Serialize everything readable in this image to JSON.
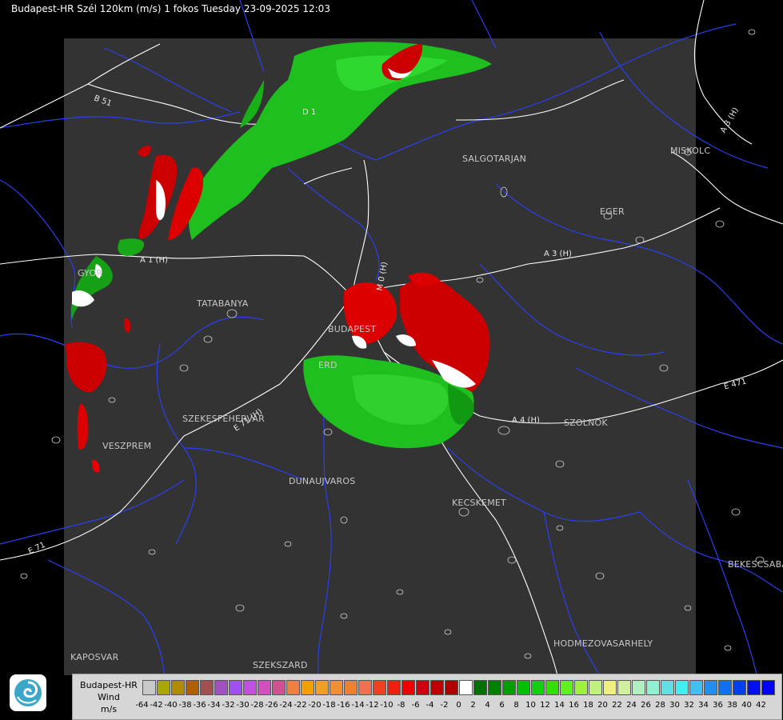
{
  "header": {
    "title": "Budapest-HR Szél 120km (m/s) 1 fokos Tuesday 23-09-2025 12:03"
  },
  "map": {
    "background_color": "#000000",
    "radar_area_color": "#333333",
    "border_color": "#3a3af0",
    "road_color": "#ffffff",
    "cities": [
      {
        "key": "salgotarjan",
        "label": "SALGOTARJAN"
      },
      {
        "key": "miskolc",
        "label": "MISKOLC"
      },
      {
        "key": "eger",
        "label": "EGER"
      },
      {
        "key": "tatabanya",
        "label": "TATABANYA"
      },
      {
        "key": "budapest",
        "label": "BUDAPEST"
      },
      {
        "key": "erd",
        "label": "ERD"
      },
      {
        "key": "szekesfehervar",
        "label": "SZEKESFEHERVAR"
      },
      {
        "key": "veszprem",
        "label": "VESZPREM"
      },
      {
        "key": "szolnok",
        "label": "SZOLNOK"
      },
      {
        "key": "dunaujvaros",
        "label": "DUNAUJVAROS"
      },
      {
        "key": "kecskemet",
        "label": "KECSKEMET"
      },
      {
        "key": "bekescsaba",
        "label": "BEKESCSABA"
      },
      {
        "key": "hodmezovasarhely",
        "label": "HODMEZOVASARHELY"
      },
      {
        "key": "kaposvar",
        "label": "KAPOSVAR"
      },
      {
        "key": "szekszard",
        "label": "SZEKSZARD"
      },
      {
        "key": "gyor",
        "label": "GYOR"
      }
    ],
    "roads": [
      {
        "key": "b51",
        "label": "B 51"
      },
      {
        "key": "d1",
        "label": "D 1"
      },
      {
        "key": "a3h_ne",
        "label": "A 3 (H)"
      },
      {
        "key": "a3h",
        "label": "A 3 (H)"
      },
      {
        "key": "a1h",
        "label": "A 1 (H)"
      },
      {
        "key": "m0",
        "label": "M 0 (H)"
      },
      {
        "key": "e471",
        "label": "E 471"
      },
      {
        "key": "a4h",
        "label": "A 4 (H)"
      },
      {
        "key": "e71",
        "label": "E 71 (H)"
      },
      {
        "key": "e71b",
        "label": "E 71"
      }
    ]
  },
  "legend": {
    "title": "Budapest-HR",
    "subtitle": "Wind",
    "unit": "m/s",
    "scale": [
      {
        "value": "-64",
        "color": "#c8c8c8"
      },
      {
        "value": "-42",
        "color": "#a8a800"
      },
      {
        "value": "-40",
        "color": "#b08c00"
      },
      {
        "value": "-38",
        "color": "#b06000"
      },
      {
        "value": "-36",
        "color": "#a05050"
      },
      {
        "value": "-34",
        "color": "#a050c0"
      },
      {
        "value": "-32",
        "color": "#a050f0"
      },
      {
        "value": "-30",
        "color": "#c050e0"
      },
      {
        "value": "-28",
        "color": "#d050c0"
      },
      {
        "value": "-26",
        "color": "#d05090"
      },
      {
        "value": "-24",
        "color": "#f08040"
      },
      {
        "value": "-22",
        "color": "#f0a000"
      },
      {
        "value": "-20",
        "color": "#f0a020"
      },
      {
        "value": "-18",
        "color": "#f09030"
      },
      {
        "value": "-16",
        "color": "#f08030"
      },
      {
        "value": "-14",
        "color": "#f07050"
      },
      {
        "value": "-12",
        "color": "#f04020"
      },
      {
        "value": "-10",
        "color": "#f02010"
      },
      {
        "value": "-8",
        "color": "#f00000"
      },
      {
        "value": "-6",
        "color": "#d00010"
      },
      {
        "value": "-4",
        "color": "#c00000"
      },
      {
        "value": "-2",
        "color": "#b00000"
      },
      {
        "value": "0",
        "color": "#ffffff"
      },
      {
        "value": "2",
        "color": "#007000"
      },
      {
        "value": "4",
        "color": "#008000"
      },
      {
        "value": "6",
        "color": "#00a000"
      },
      {
        "value": "8",
        "color": "#00c000"
      },
      {
        "value": "10",
        "color": "#10d010"
      },
      {
        "value": "12",
        "color": "#30e000"
      },
      {
        "value": "14",
        "color": "#60f020"
      },
      {
        "value": "16",
        "color": "#a0f040"
      },
      {
        "value": "18",
        "color": "#c0f080"
      },
      {
        "value": "20",
        "color": "#f0f080"
      },
      {
        "value": "22",
        "color": "#d0f0a0"
      },
      {
        "value": "24",
        "color": "#b0f0c0"
      },
      {
        "value": "26",
        "color": "#90f0d0"
      },
      {
        "value": "28",
        "color": "#60e0e0"
      },
      {
        "value": "30",
        "color": "#40f0f0"
      },
      {
        "value": "32",
        "color": "#40c0f0"
      },
      {
        "value": "34",
        "color": "#2090f0"
      },
      {
        "value": "36",
        "color": "#1070f0"
      },
      {
        "value": "38",
        "color": "#0040f0"
      },
      {
        "value": "40",
        "color": "#0010f0"
      },
      {
        "value": "42",
        "color": "#0000ff"
      }
    ]
  }
}
